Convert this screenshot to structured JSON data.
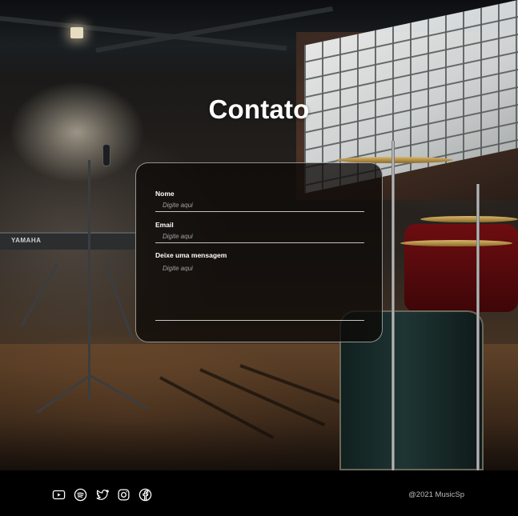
{
  "page": {
    "title": "Contato"
  },
  "scene": {
    "keyboard_brand": "YAMAHA"
  },
  "form": {
    "fields": [
      {
        "label": "Nome",
        "placeholder": "Digite aqui",
        "value": ""
      },
      {
        "label": "Email",
        "placeholder": "Digite aqui",
        "value": ""
      },
      {
        "label": "Deixe uma mensagem",
        "placeholder": "Digite aqui",
        "value": ""
      }
    ]
  },
  "footer": {
    "social": [
      {
        "icon": "youtube-icon"
      },
      {
        "icon": "spotify-icon"
      },
      {
        "icon": "twitter-icon"
      },
      {
        "icon": "instagram-icon"
      },
      {
        "icon": "facebook-icon"
      }
    ],
    "copyright": "@2021 MusicSp"
  },
  "colors": {
    "footer_bg": "#000000",
    "card_border": "#ffffff",
    "text": "#ffffff"
  }
}
